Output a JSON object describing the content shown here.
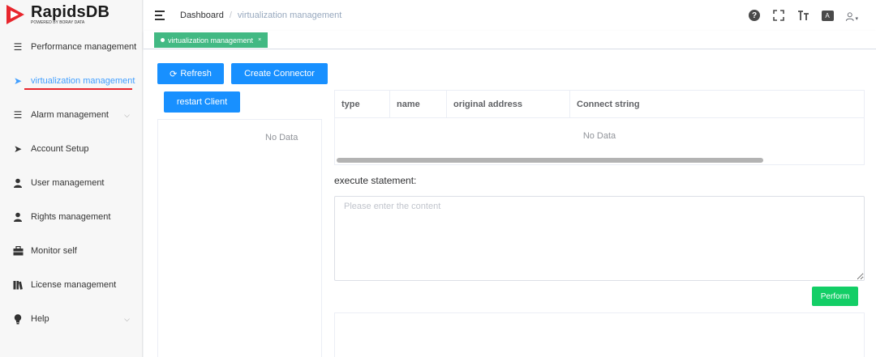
{
  "logo": {
    "name": "RapidsDB",
    "subtitle": "POWERED BY BORAY DATA",
    "brand_color": "#e8262d"
  },
  "sidebar": {
    "items": [
      {
        "label": "Performance management",
        "icon": "list-icon",
        "has_submenu": false,
        "active": false
      },
      {
        "label": "virtualization management",
        "icon": "send-icon",
        "has_submenu": false,
        "active": true
      },
      {
        "label": "Alarm management",
        "icon": "list-icon",
        "has_submenu": true,
        "active": false
      },
      {
        "label": "Account Setup",
        "icon": "send-icon",
        "has_submenu": false,
        "active": false
      },
      {
        "label": "User management",
        "icon": "user-icon",
        "has_submenu": false,
        "active": false
      },
      {
        "label": "Rights management",
        "icon": "user-icon",
        "has_submenu": false,
        "active": false
      },
      {
        "label": "Monitor self",
        "icon": "briefcase-icon",
        "has_submenu": false,
        "active": false
      },
      {
        "label": "License management",
        "icon": "books-icon",
        "has_submenu": false,
        "active": false
      },
      {
        "label": "Help",
        "icon": "lightbulb-icon",
        "has_submenu": true,
        "active": false
      }
    ]
  },
  "header": {
    "breadcrumb": {
      "home": "Dashboard",
      "separator": "/",
      "current": "virtualization management"
    },
    "icons": [
      "help-icon",
      "fullscreen-icon",
      "font-size-icon",
      "language-icon",
      "user-icon"
    ]
  },
  "tags": [
    {
      "label": "virtualization management",
      "close": "×",
      "color": "#42b983"
    }
  ],
  "main": {
    "refresh_label": "Refresh",
    "create_connector_label": "Create Connector",
    "restart_client_label": "restart Client",
    "left_panel_empty": "No Data",
    "table": {
      "columns": [
        "type",
        "name",
        "original address",
        "Connect string"
      ],
      "empty_text": "No Data"
    },
    "execute_label": "execute statement:",
    "textarea_placeholder": "Please enter the content",
    "textarea_value": "",
    "perform_label": "Perform",
    "accent_color": "#1890ff",
    "perform_color": "#13ce66"
  }
}
